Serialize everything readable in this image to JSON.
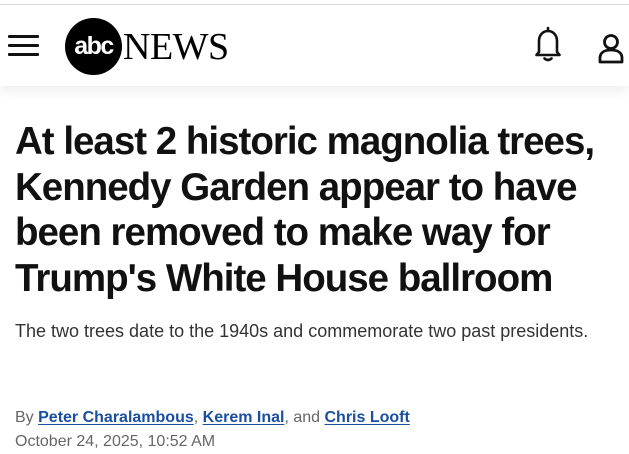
{
  "header": {
    "logo_mark": "abc",
    "logo_word": "NEWS"
  },
  "article": {
    "headline": "At least 2 historic magnolia trees, Kennedy Garden appear to have been removed to make way for Trump's White House ballroom",
    "subheadline": "The two trees date to the 1940s and commemorate two past presidents.",
    "byline": {
      "prefix": "By",
      "authors": [
        "Peter Charalambous",
        "Kerem Inal",
        "Chris Looft"
      ],
      "separator": ",",
      "conjunction": ", and"
    },
    "timestamp": "October 24, 2025, 10:52 AM"
  },
  "colors": {
    "author_link": "#1a4fa0",
    "meta_text": "#666666"
  },
  "icons": [
    "hamburger-menu-icon",
    "bell-icon",
    "user-icon"
  ]
}
